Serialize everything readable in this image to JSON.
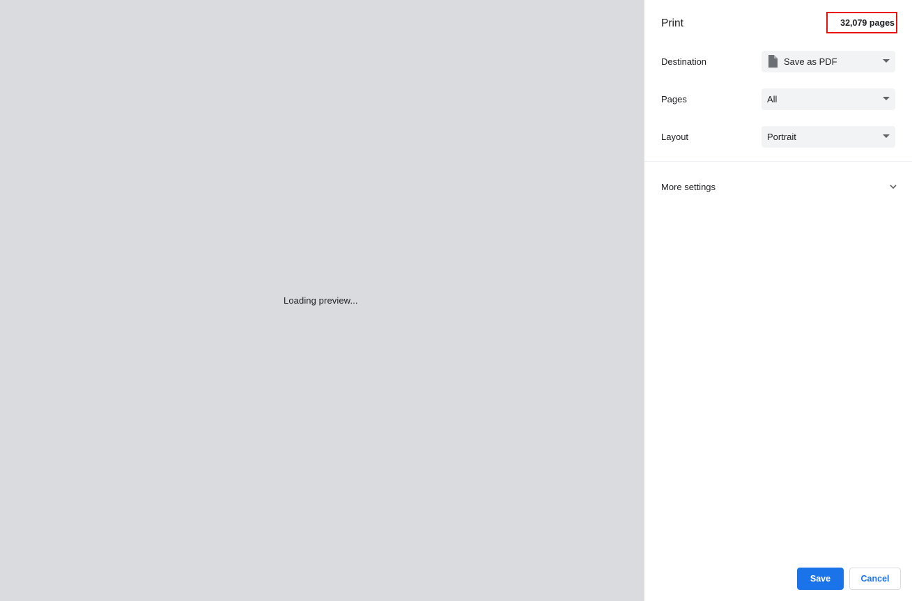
{
  "preview": {
    "message": "Loading preview..."
  },
  "sidebar": {
    "title": "Print",
    "page_count": "32,079 pages",
    "destination": {
      "label": "Destination",
      "value": "Save as PDF",
      "icon": "document-icon"
    },
    "pages": {
      "label": "Pages",
      "value": "All"
    },
    "layout": {
      "label": "Layout",
      "value": "Portrait"
    },
    "more_settings": {
      "label": "More settings",
      "icon": "chevron-down-icon"
    }
  },
  "actions": {
    "save_label": "Save",
    "cancel_label": "Cancel"
  },
  "colors": {
    "accent": "#1a73e8",
    "highlight_box": "#e8130c",
    "preview_bg": "#dadbde",
    "select_bg": "#f1f3f4"
  }
}
